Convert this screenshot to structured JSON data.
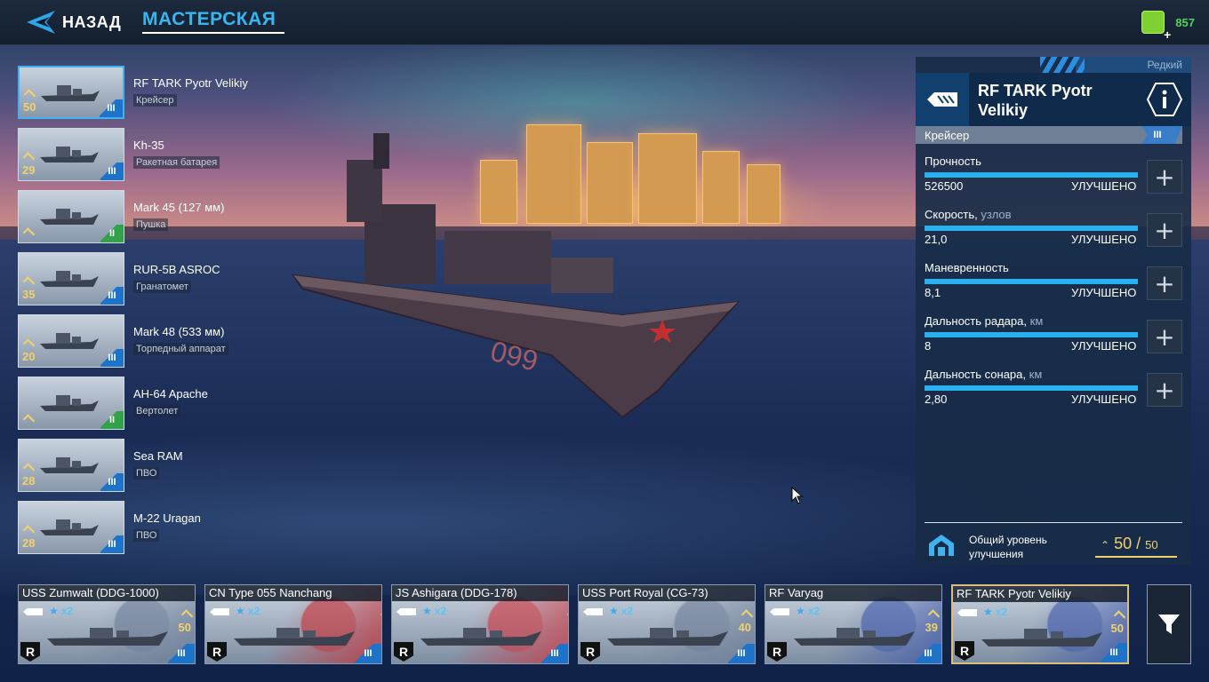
{
  "topbar": {
    "back_label": "НАЗАД",
    "title": "МАСТЕРСКАЯ",
    "currency_value": "857",
    "currency_icon": "premium-currency-icon"
  },
  "equipment": [
    {
      "name": "RF TARK Pyotr Velikiy",
      "type": "Крейсер",
      "level": "50",
      "tier": "III",
      "tier_color": "blue",
      "selected": true,
      "icon": "cruiser-icon"
    },
    {
      "name": "Kh-35",
      "type": "Ракетная батарея",
      "level": "29",
      "tier": "III",
      "tier_color": "blue",
      "icon": "missile-icon"
    },
    {
      "name": "Mark 45 (127 мм)",
      "type": "Пушка",
      "level": "",
      "tier": "II",
      "tier_color": "green",
      "icon": "gun-turret-icon"
    },
    {
      "name": "RUR-5B ASROC",
      "type": "Гранатомет",
      "level": "35",
      "tier": "III",
      "tier_color": "blue",
      "icon": "launcher-icon"
    },
    {
      "name": "Mark 48 (533 мм)",
      "type": "Торпедный аппарат",
      "level": "20",
      "tier": "III",
      "tier_color": "blue",
      "icon": "torpedo-icon"
    },
    {
      "name": "AH-64 Apache",
      "type": "Вертолет",
      "level": "",
      "tier": "II",
      "tier_color": "green",
      "icon": "helicopter-icon"
    },
    {
      "name": "Sea RAM",
      "type": "ПВО",
      "level": "28",
      "tier": "III",
      "tier_color": "blue",
      "icon": "air-defense-icon"
    },
    {
      "name": "M-22 Uragan",
      "type": "ПВО",
      "level": "28",
      "tier": "III",
      "tier_color": "blue",
      "icon": "air-defense-icon"
    }
  ],
  "panel": {
    "rarity": "Редкий",
    "ship_name": "RF TARK Pyotr Velikiy",
    "class": "Крейсер",
    "tier": "III",
    "stats": [
      {
        "label": "Прочность",
        "unit": "",
        "value": "526500",
        "status": "УЛУЧШЕНО",
        "fill": 1.0
      },
      {
        "label": "Скорость,",
        "unit": "узлов",
        "value": "21,0",
        "status": "УЛУЧШЕНО",
        "fill": 1.0
      },
      {
        "label": "Маневренность",
        "unit": "",
        "value": "8,1",
        "status": "УЛУЧШЕНО",
        "fill": 1.0
      },
      {
        "label": "Дальность радара,",
        "unit": "км",
        "value": "8",
        "status": "УЛУЧШЕНО",
        "fill": 1.0
      },
      {
        "label": "Дальность сонара,",
        "unit": "км",
        "value": "2,80",
        "status": "УЛУЧШЕНО",
        "fill": 1.0
      }
    ],
    "total_label": "Общий уровень улучшения",
    "total_value": "50",
    "total_separator": "/",
    "total_max": "50"
  },
  "fleet": [
    {
      "name": "USS Zumwalt (DDG-1000)",
      "stars": "x2",
      "level": "50",
      "tier": "III",
      "flag": "#6a7a96"
    },
    {
      "name": "CN Type 055 Nanchang",
      "stars": "x2",
      "level": "",
      "tier": "III",
      "flag": "#c8262c"
    },
    {
      "name": "JS Ashigara (DDG-178)",
      "stars": "x2",
      "level": "",
      "tier": "III",
      "flag": "#d03038"
    },
    {
      "name": "USS Port Royal (CG-73)",
      "stars": "x2",
      "level": "40",
      "tier": "III",
      "flag": "#6a7a96"
    },
    {
      "name": "RF Varyag",
      "stars": "x2",
      "level": "39",
      "tier": "III",
      "flag": "#3752a8"
    },
    {
      "name": "RF TARK Pyotr Velikiy",
      "stars": "x2",
      "level": "50",
      "tier": "III",
      "flag": "#3752a8",
      "selected": true
    }
  ],
  "nation_mark": "R",
  "scene": {
    "hull_number": "099"
  }
}
